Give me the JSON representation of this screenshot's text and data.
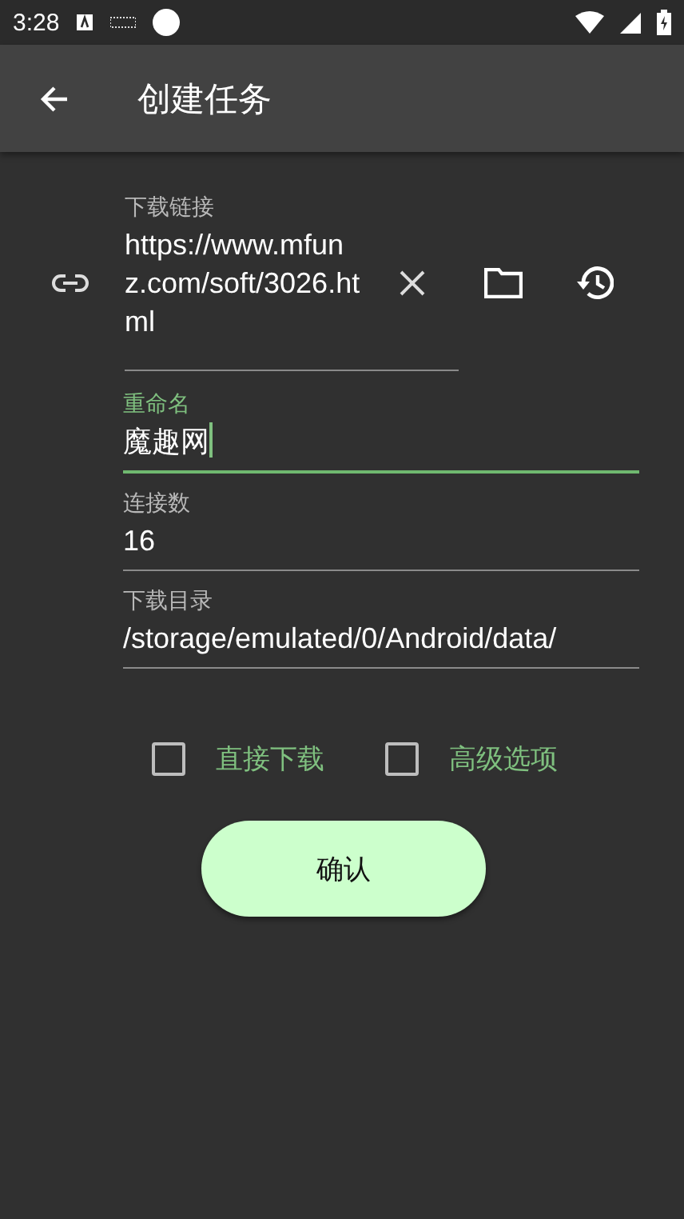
{
  "status_bar": {
    "time": "3:28"
  },
  "app_bar": {
    "title": "创建任务"
  },
  "fields": [
    {
      "kind": "url",
      "label": "下载链接",
      "value": "https://www.mfunz.com/soft/3026.html",
      "focused": false
    },
    {
      "kind": "text",
      "label": "重命名",
      "value": "魔趣网",
      "focused": true
    },
    {
      "kind": "text",
      "label": "连接数",
      "value": "16",
      "focused": false
    },
    {
      "kind": "text",
      "label": "下载目录",
      "value": "/storage/emulated/0/Android/data/",
      "focused": false
    }
  ],
  "options": [
    {
      "label": "直接下载",
      "checked": false
    },
    {
      "label": "高级选项",
      "checked": false
    }
  ],
  "confirm_button": "确认"
}
